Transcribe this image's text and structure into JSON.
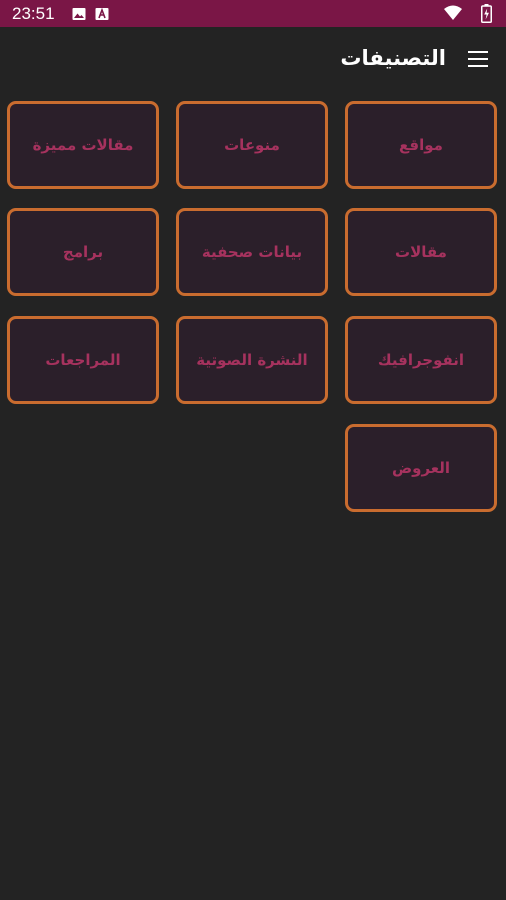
{
  "status_bar": {
    "time": "23:51",
    "icons": [
      "image-notification-icon",
      "app-notification-icon",
      "wifi-icon",
      "battery-icon"
    ]
  },
  "app_bar": {
    "title": "التصنيفات",
    "menu_icon": "menu-icon"
  },
  "colors": {
    "status_bar": "#7a1646",
    "background": "#232323",
    "tile_border": "#c96c2f",
    "tile_fill": "#2b1f2a",
    "tile_text": "#a6325e"
  },
  "categories": [
    {
      "label": "مواقع"
    },
    {
      "label": "منوعات"
    },
    {
      "label": "مقالات مميزة"
    },
    {
      "label": "مقالات"
    },
    {
      "label": "بيانات صحفية"
    },
    {
      "label": "برامج"
    },
    {
      "label": "انفوجرافيك"
    },
    {
      "label": "النشرة الصوتية"
    },
    {
      "label": "المراجعات"
    },
    {
      "label": "العروض"
    }
  ]
}
